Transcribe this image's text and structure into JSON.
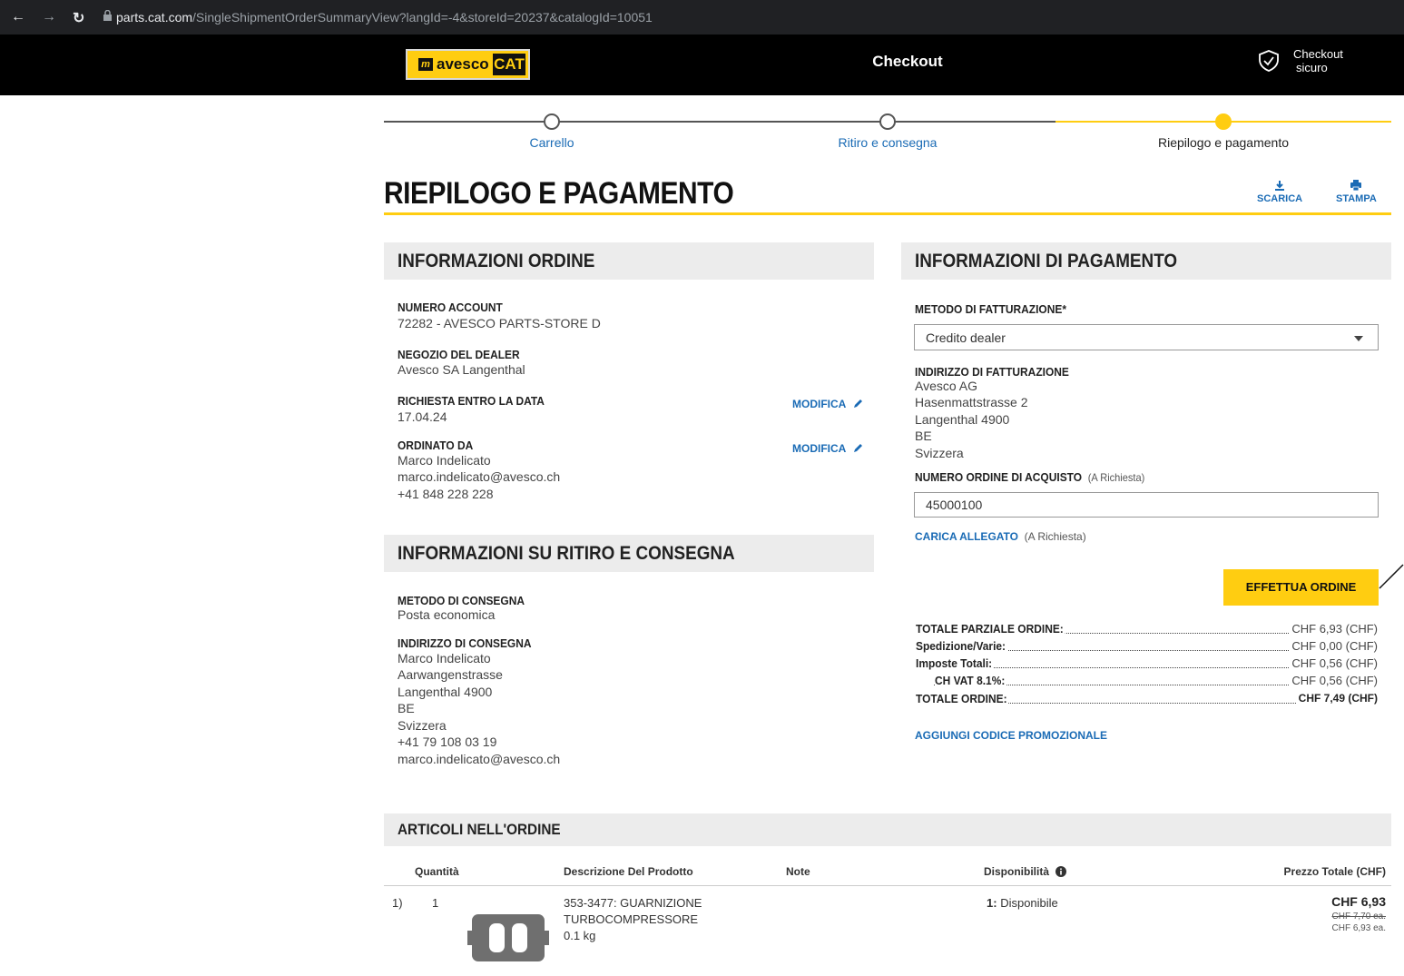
{
  "browser": {
    "url_host": "parts.cat.com",
    "url_path": "/SingleShipmentOrderSummaryView?langId=-4&storeId=20237&catalogId=10051"
  },
  "header": {
    "logo_text": "avesco",
    "logo_cat": "CAT",
    "title": "Checkout",
    "secure_line1": "Checkout",
    "secure_line2": "sicuro"
  },
  "stepper": {
    "steps": [
      {
        "label": "Carrello",
        "state": "done"
      },
      {
        "label": "Ritiro e consegna",
        "state": "done"
      },
      {
        "label": "Riepilogo e pagamento",
        "state": "current"
      }
    ]
  },
  "page": {
    "title": "RIEPILOGO E PAGAMENTO",
    "download_label": "SCARICA",
    "print_label": "STAMPA"
  },
  "order_info": {
    "heading": "INFORMAZIONI ORDINE",
    "account_label": "NUMERO ACCOUNT",
    "account_value": "72282 - AVESCO PARTS-STORE D",
    "dealer_label": "NEGOZIO DEL DEALER",
    "dealer_value": "Avesco SA Langenthal",
    "date_label": "RICHIESTA ENTRO LA DATA",
    "date_value": "17.04.24",
    "edit_label": "MODIFICA",
    "ordered_by_label": "ORDINATO DA",
    "ordered_by_name": "Marco Indelicato",
    "ordered_by_email": "marco.indelicato@avesco.ch",
    "ordered_by_phone": "+41 848 228 228"
  },
  "delivery_info": {
    "heading": "INFORMAZIONI SU RITIRO E CONSEGNA",
    "method_label": "METODO DI CONSEGNA",
    "method_value": "Posta economica",
    "address_label": "INDIRIZZO DI CONSEGNA",
    "address_lines": [
      "Marco Indelicato",
      "Aarwangenstrasse",
      "Langenthal 4900",
      "BE",
      "Svizzera",
      "+41 79 108 03 19",
      "marco.indelicato@avesco.ch"
    ]
  },
  "payment_info": {
    "heading": "INFORMAZIONI DI PAGAMENTO",
    "billing_method_label": "METODO DI FATTURAZIONE*",
    "billing_method_value": "Credito dealer",
    "billing_address_label": "INDIRIZZO DI FATTURAZIONE",
    "billing_address_lines": [
      "Avesco AG",
      "Hasenmattstrasse 2",
      "Langenthal 4900",
      "BE",
      "Svizzera"
    ],
    "po_label": "NUMERO ORDINE DI ACQUISTO",
    "optional_note": "(A Richiesta)",
    "po_value": "45000100",
    "attachment_label": "CARICA ALLEGATO",
    "place_order_label": "EFFETTUA ORDINE",
    "promo_label": "AGGIUNGI CODICE PROMOZIONALE"
  },
  "totals": [
    {
      "label": "TOTALE PARZIALE ORDINE:",
      "value": "CHF 6,93 (CHF)"
    },
    {
      "label": "Spedizione/Varie:",
      "value": "CHF 0,00 (CHF)"
    },
    {
      "label": "Imposte Totali:",
      "value": "CHF 0,56 (CHF)"
    },
    {
      "label": "CH VAT 8.1%:",
      "value": "CHF 0,56 (CHF)"
    },
    {
      "label": "TOTALE ORDINE:",
      "value": "CHF 7,49 (CHF)"
    }
  ],
  "items": {
    "heading": "ARTICOLI NELL'ORDINE",
    "columns": [
      "Quantità",
      "Descrizione Del Prodotto",
      "Note",
      "Disponibilità",
      "Prezzo Totale (CHF)"
    ],
    "rows": [
      {
        "index": "1)",
        "qty": "1",
        "desc_line1": "353-3477: GUARNIZIONE",
        "desc_line2": "TURBOCOMPRESSORE",
        "weight": "0.1 kg",
        "availability_qty": "1:",
        "availability_text": "Disponibile",
        "price": "CHF 6,93",
        "old_price": "CHF 7,70 ea.",
        "unit_price": "CHF 6,93 ea."
      }
    ]
  },
  "colors": {
    "accent": "#ffcd11",
    "link": "#1a6bb5"
  }
}
